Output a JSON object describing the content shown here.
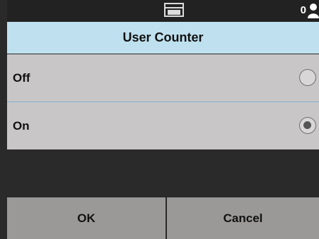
{
  "status_bar": {
    "device_icon": "printer-icon",
    "user_count": "0",
    "user_icon": "user-icon"
  },
  "title": "User Counter",
  "options": [
    {
      "label": "Off",
      "selected": false
    },
    {
      "label": "On",
      "selected": true
    }
  ],
  "buttons": {
    "ok_label": "OK",
    "cancel_label": "Cancel"
  },
  "colors": {
    "title_background": "#bfe0ee",
    "row_background": "#c9c6c8",
    "button_background": "#9a9998",
    "screen_background": "#2a2a2a"
  }
}
